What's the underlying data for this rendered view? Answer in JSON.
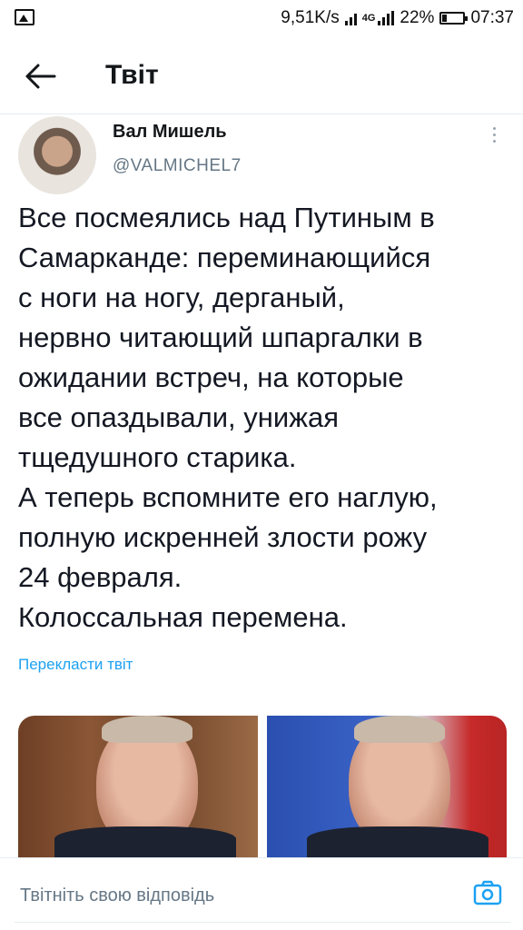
{
  "status_bar": {
    "gallery_icon": "image-icon",
    "speed": "9,51K/s",
    "network": "4G",
    "battery": "22%",
    "time": "07:37"
  },
  "header": {
    "back_icon": "arrow-left-icon",
    "title": "Твіт"
  },
  "tweet": {
    "author_name": "Вал Мишель",
    "author_handle": "@VALMICHEL7",
    "more_icon": "more-vertical-icon",
    "text_lines": [
      "Все посмеялись над Путиным в",
      "Самарканде: переминающийся",
      "с ноги на ногу, дерганый,",
      "нервно читающий шпаргалки в",
      "ожидании встреч, на которые",
      "все опаздывали, унижая",
      "тщедушного старика.",
      "А теперь вспомните его наглую,",
      "полную искренней злости рожу",
      "24 февраля.",
      "Колоссальная перемена."
    ],
    "translate_label": "Перекласти твіт"
  },
  "reply": {
    "placeholder": "Твітніть свою відповідь",
    "camera_icon": "camera-icon"
  },
  "colors": {
    "accent": "#1da1f2",
    "secondary_text": "#657786",
    "primary_text": "#141823"
  }
}
